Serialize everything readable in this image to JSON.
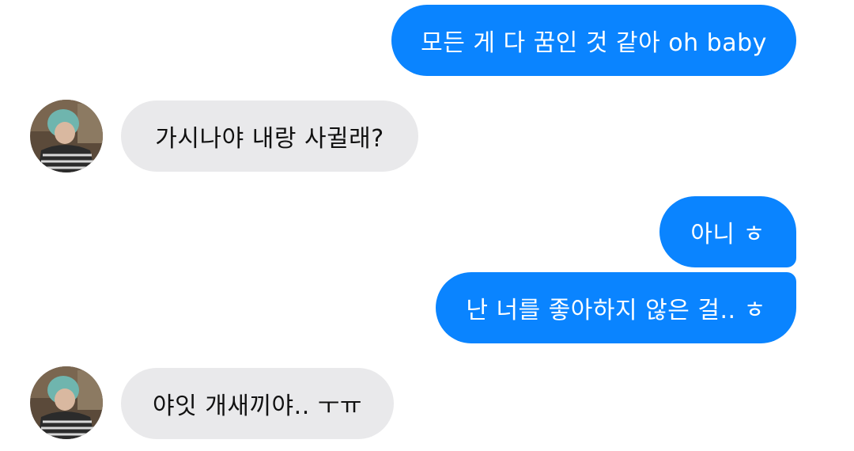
{
  "conversation": {
    "messages": [
      {
        "sender": "me",
        "text": "모든 게 다 꿈인 것 같아 oh baby"
      },
      {
        "sender": "other",
        "text": "가시나야 내랑 사귈래?"
      },
      {
        "sender": "me",
        "text": "아니 ㅎ"
      },
      {
        "sender": "me",
        "text": "난 너를 좋아하지 않은 걸.. ㅎ"
      },
      {
        "sender": "other",
        "text": "야잇 개새끼야.. ㅜㅠ"
      }
    ]
  },
  "colors": {
    "outgoing_bubble": "#0a84ff",
    "incoming_bubble": "#e9e9eb",
    "background": "#ffffff"
  },
  "icons": {
    "avatar": "contact-avatar-photo"
  }
}
